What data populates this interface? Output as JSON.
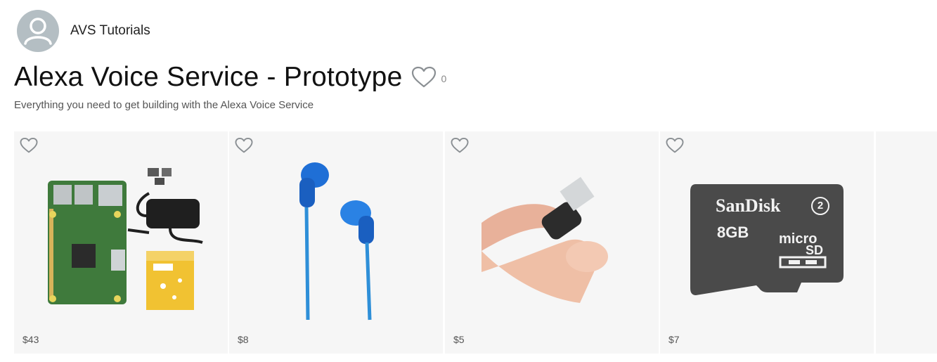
{
  "author": {
    "name": "AVS Tutorials",
    "avatar_icon": "user-silhouette-icon"
  },
  "list": {
    "title": "Alexa Voice Service - Prototype",
    "like_count": "0",
    "subtitle": "Everything you need to get building with the Alexa Voice Service"
  },
  "products": [
    {
      "price": "$43",
      "image": "raspberry-pi-kit"
    },
    {
      "price": "$8",
      "image": "blue-earbuds"
    },
    {
      "price": "$5",
      "image": "usb-microphone"
    },
    {
      "price": "$7",
      "image": "sandisk-microsd-8gb",
      "brand_text": "SanDisk",
      "capacity_text": "8GB"
    }
  ],
  "colors": {
    "card_bg": "#f6f6f6",
    "avatar_bg": "#b4bec3",
    "heart_stroke": "#8a8f93"
  }
}
